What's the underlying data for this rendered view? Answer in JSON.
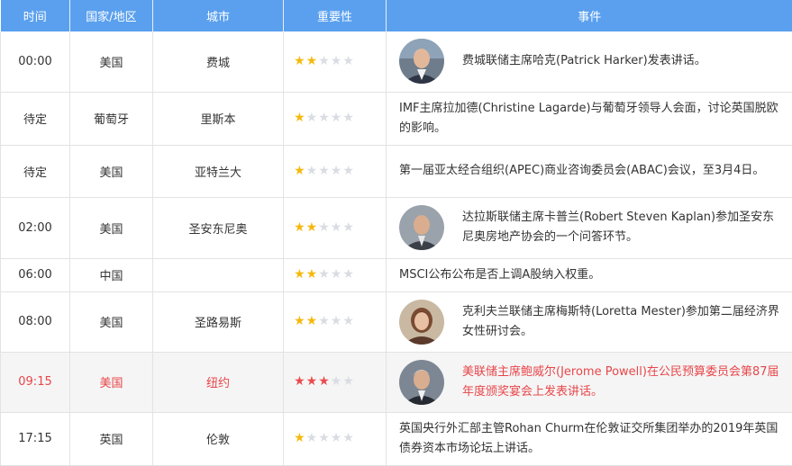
{
  "headers": [
    "时间",
    "国家/地区",
    "城市",
    "重要性",
    "事件"
  ],
  "colors": {
    "header_bg": "#5aa0ee",
    "star_on": "#f5b90d",
    "star_high": "#ea4b4f",
    "star_off": "#d9dde3",
    "highlight_text": "#e8464a"
  },
  "rows": [
    {
      "time": "00:00",
      "country": "美国",
      "city": "费城",
      "importance": 2,
      "avatar": "portrait-harker",
      "event": "费城联储主席哈克(Patrick Harker)发表讲话。"
    },
    {
      "time": "待定",
      "country": "葡萄牙",
      "city": "里斯本",
      "importance": 1,
      "avatar": null,
      "event": "IMF主席拉加德(Christine Lagarde)与葡萄牙领导人会面，讨论英国脱欧的影响。"
    },
    {
      "time": "待定",
      "country": "美国",
      "city": "亚特兰大",
      "importance": 1,
      "avatar": null,
      "event": "第一届亚太经合组织(APEC)商业咨询委员会(ABAC)会议，至3月4日。"
    },
    {
      "time": "02:00",
      "country": "美国",
      "city": "圣安东尼奥",
      "importance": 2,
      "avatar": "portrait-kaplan",
      "event": "达拉斯联储主席卡普兰(Robert Steven Kaplan)参加圣安东尼奥房地产协会的一个问答环节。"
    },
    {
      "time": "06:00",
      "country": "中国",
      "city": "",
      "importance": 2,
      "avatar": null,
      "event": "MSCI公布公布是否上调A股纳入权重。"
    },
    {
      "time": "08:00",
      "country": "美国",
      "city": "圣路易斯",
      "importance": 2,
      "avatar": "portrait-mester",
      "event": "克利夫兰联储主席梅斯特(Loretta Mester)参加第二届经济界女性研讨会。"
    },
    {
      "time": "09:15",
      "country": "美国",
      "city": "纽约",
      "importance": 3,
      "avatar": "portrait-powell",
      "highlight": true,
      "event": "美联储主席鲍威尔(Jerome Powell)在公民预算委员会第87届年度颁奖宴会上发表讲话。"
    },
    {
      "time": "17:15",
      "country": "英国",
      "city": "伦敦",
      "importance": 1,
      "avatar": null,
      "event": "英国央行外汇部主管Rohan Churm在伦敦证交所集团举办的2019年英国债券资本市场论坛上讲话。"
    }
  ]
}
